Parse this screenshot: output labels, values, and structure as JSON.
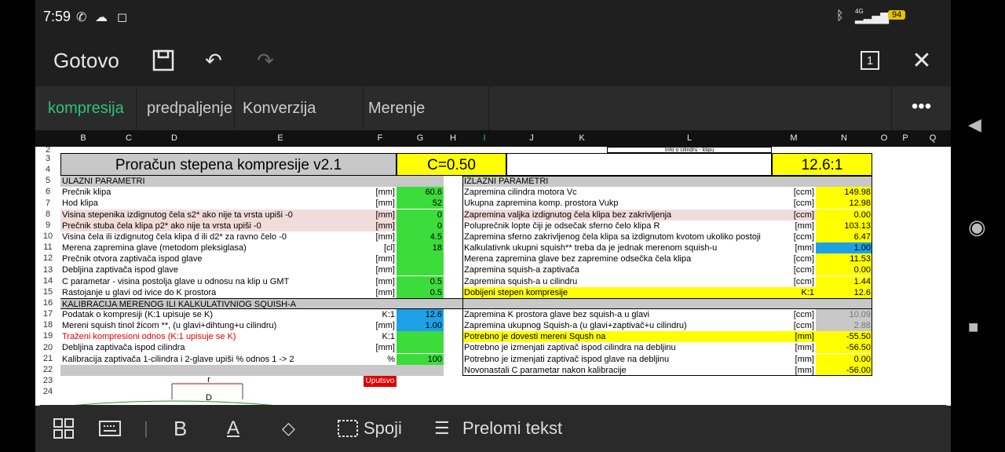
{
  "status": {
    "time": "7:59",
    "battery": "94",
    "network": "4G"
  },
  "topbar": {
    "done_label": "Gotovo",
    "sheet_count": "1"
  },
  "tabs": [
    "kompresija",
    "predpaljenje",
    "Konverzija uglova",
    "Merenje auspuha"
  ],
  "columns": [
    "B",
    "C",
    "D",
    "E",
    "F",
    "G",
    "H",
    "I",
    "J",
    "K",
    "L",
    "M",
    "N",
    "O",
    "P",
    "Q"
  ],
  "sheet": {
    "info_label": "Info o cilindru - klipu",
    "title": "Proračun stepena kompresije v2.1",
    "c_value": "C=0.50",
    "ratio": "12.6:1",
    "input_header": "ULAZNI PARAMETRI",
    "output_header": "IZLAZNI PARAMETRI",
    "calib_header": "KALIBRACIJA MERENOG ILI KALKULATIVNIOG SQUISH-A",
    "uputsvo": "Uputsvo",
    "drawing_r": "r",
    "drawing_d": "D",
    "left_rows": [
      {
        "label": "Prečnik klipa",
        "unit": "[mm]",
        "value": "60.6"
      },
      {
        "label": "Hod klipa",
        "unit": "[mm]",
        "value": "52"
      },
      {
        "label": "Visina stepenika izdignutog čela s2* ako nije ta vrsta upiši -0",
        "unit": "[mm]",
        "value": "0"
      },
      {
        "label": "Prečnik stuba čela klipa p2* ako nije ta vrsta upiši -0",
        "unit": "[mm]",
        "value": "0"
      },
      {
        "label": "Visina čela ili izdignutog čela klipa d ili d2* za ravno čelo -0",
        "unit": "[mm]",
        "value": "4.5"
      },
      {
        "label": "Merena zapremina glave (metodom pleksiglasa)",
        "unit": "[cl]",
        "value": "18"
      },
      {
        "label": "Prečnik otvora zaptivača ispod glave",
        "unit": "[mm]",
        "value": ""
      },
      {
        "label": "Debljina zaptivača ispod glave",
        "unit": "[mm]",
        "value": ""
      },
      {
        "label": "C parametar - visina postolja glave u odnosu na klip u GMT",
        "unit": "[mm]",
        "value": "0.5"
      },
      {
        "label": "Rastojanje u glavi od ivice do K prostora",
        "unit": "[mm]",
        "value": "0.5"
      }
    ],
    "right_rows": [
      {
        "label": "Zapremina cilindra motora Vc",
        "unit": "[ccm]",
        "value": "149.98"
      },
      {
        "label": "Ukupna zapremina komp. prostora Vukp",
        "unit": "[ccm]",
        "value": "12.98"
      },
      {
        "label": "Zapremina valjka izdignutog čela klipa bez zakrivljenja",
        "unit": "[ccm]",
        "value": "0.00"
      },
      {
        "label": "Poluprečnik lopte čiji je odsečak sferno čelo klipa R",
        "unit": "[mm]",
        "value": "103.13"
      },
      {
        "label": "Zapremina sferno zakrivljenog čela klipa sa izdignutom kvotom ukoliko postoji",
        "unit": "[ccm]",
        "value": "6.47"
      },
      {
        "label": "Kalkulativnk ukupni squish**  treba da je jednak merenom squish-u",
        "unit": "[mm]",
        "value": "1.00"
      },
      {
        "label": "Merena zapremina glave bez zapremine odsečka čela klipa",
        "unit": "[ccm]",
        "value": "11.53"
      },
      {
        "label": "Zapremina squish-a zaptivača",
        "unit": "[ccm]",
        "value": "0.00"
      },
      {
        "label": "Zapremina squish-a u cilindru",
        "unit": "[ccm]",
        "value": "1.44"
      },
      {
        "label": "Dobijeni stepen kompresije",
        "unit": "K:1",
        "value": "12.6"
      }
    ],
    "calib_left": [
      {
        "label": "Podatak o kompresiji (K:1 upisuje se K)",
        "unit": "K:1",
        "value": "12.6"
      },
      {
        "label": "Mereni squish tinol žicom **, (u glavi+dihtung+u cilindru)",
        "unit": "[mm]",
        "value": "1.00"
      },
      {
        "label": "Traženi kompresioni odnos (K:1 upisuje se K)",
        "unit": "K:1",
        "value": ""
      },
      {
        "label": "Debljina zaptivača ispod cilindra",
        "unit": "[mm]",
        "value": ""
      },
      {
        "label": "Kalibracija zaptivača 1-cilindra i 2-glave upiši % odnos 1 -> 2",
        "unit": "%",
        "value": "100"
      }
    ],
    "calib_right": [
      {
        "label": "Zapremina K prostora glave bez squish-a u glavi",
        "unit": "[ccm]",
        "value": "10.09"
      },
      {
        "label": "Zapremina ukupnog Squish-a (u glavi+zaptivač+u cilindru)",
        "unit": "[ccm]",
        "value": "2.88"
      },
      {
        "label": "Potrebno je dovesti mereni Sqush na",
        "unit": "[mm]",
        "value": "-55.50"
      },
      {
        "label": "Potrebno je izmenjati zaptivač ispod cilindra na debljinu",
        "unit": "[mm]",
        "value": "-56.50"
      },
      {
        "label": "Potrebno je izmenjati zaptivač ispod glave na debljinu",
        "unit": "[mm]",
        "value": "0.00"
      },
      {
        "label": "Novonastali C parametar nakon kalibracije",
        "unit": "[mm]",
        "value": "-56.00"
      }
    ]
  },
  "bottombar": {
    "merge_label": "Spoji",
    "wrap_label": "Prelomi tekst"
  }
}
